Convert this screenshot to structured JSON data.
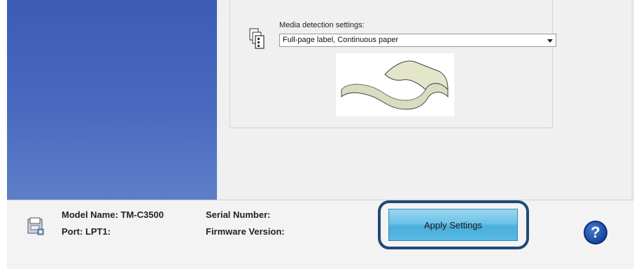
{
  "media": {
    "label": "Media detection settings:",
    "selected": "Full-page label, Continuous paper"
  },
  "device": {
    "model_label": "Model Name: TM-C3500",
    "port_label": "Port: LPT1:",
    "serial_label": "Serial Number:",
    "firmware_label": "Firmware Version:"
  },
  "actions": {
    "apply_label": "Apply Settings",
    "help_label": "?"
  },
  "icons": {
    "media": "media-pages-icon",
    "printer": "printer-icon",
    "help": "help-icon"
  },
  "colors": {
    "sidebar": "#4a6ac0",
    "button": "#5cb8e4",
    "highlight": "#1f4a78",
    "help": "#1d4fa6"
  }
}
